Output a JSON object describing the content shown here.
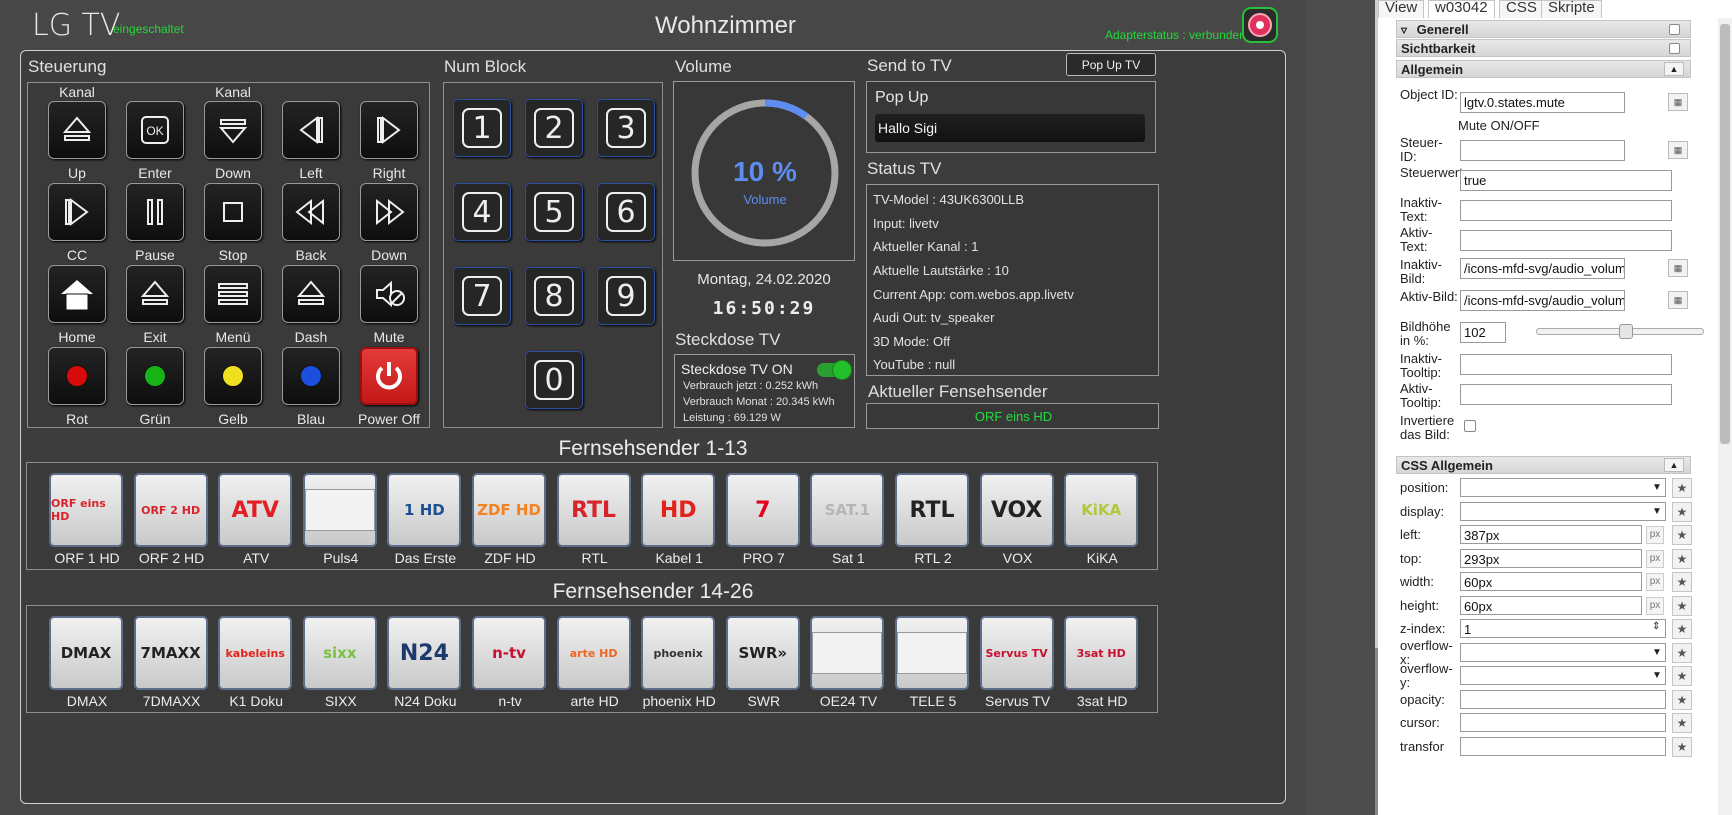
{
  "header": {
    "app_title": "LG TV",
    "app_state": "eingeschaltet",
    "room": "Wohnzimmer",
    "adapter_status": "Adapterstatus : verbunden"
  },
  "sections": {
    "control": "Steuerung",
    "numblock": "Num Block",
    "volume": "Volume",
    "send_to_tv": "Send to TV",
    "status_tv": "Status TV",
    "plug": "Steckdose TV",
    "current_sender": "Aktueller Fensehsender"
  },
  "control": {
    "top_labels": [
      "Kanal",
      "Kanal"
    ],
    "buttons": [
      {
        "label": "Up",
        "icon": "eject-up-icon"
      },
      {
        "label": "Enter",
        "icon": "ok-icon"
      },
      {
        "label": "Down",
        "icon": "eject-down-icon"
      },
      {
        "label": "Left",
        "icon": "arrow-left-icon"
      },
      {
        "label": "Right",
        "icon": "arrow-right-icon"
      },
      {
        "label": "CC",
        "icon": "play-icon"
      },
      {
        "label": "Pause",
        "icon": "pause-icon"
      },
      {
        "label": "Stop",
        "icon": "stop-icon"
      },
      {
        "label": "Back",
        "icon": "rewind-icon"
      },
      {
        "label": "Down",
        "icon": "fast-forward-icon"
      },
      {
        "label": "Home",
        "icon": "home-icon"
      },
      {
        "label": "Exit",
        "icon": "eject-icon"
      },
      {
        "label": "Menü",
        "icon": "menu-icon"
      },
      {
        "label": "Dash",
        "icon": "dash-icon"
      },
      {
        "label": "Mute",
        "icon": "mute-icon"
      },
      {
        "label": "Rot",
        "icon": "red-dot-icon"
      },
      {
        "label": "Grün",
        "icon": "green-dot-icon"
      },
      {
        "label": "Gelb",
        "icon": "yellow-dot-icon"
      },
      {
        "label": "Blau",
        "icon": "blue-dot-icon"
      },
      {
        "label": "Power Off",
        "icon": "power-icon"
      }
    ]
  },
  "numblock": {
    "keys": [
      "1",
      "2",
      "3",
      "4",
      "5",
      "6",
      "7",
      "8",
      "9",
      "0"
    ]
  },
  "volume": {
    "value": 10,
    "text": "10 %",
    "label": "Volume",
    "accent": "#5d8df0"
  },
  "clock": {
    "date": "Montag, 24.02.2020",
    "time": "16:50:29"
  },
  "plug": {
    "title": "Steckdose TV ON",
    "on": true,
    "lines": [
      "Verbrauch jetzt : 0.252 kWh",
      "Verbrauch Monat : 20.345 kWh",
      "Leistung : 69.129 W"
    ]
  },
  "send": {
    "popup_button": "Pop Up TV",
    "popup_label": "Pop Up",
    "popup_value": "Hallo Sigi"
  },
  "status": {
    "lines": [
      "TV-Model : 43UK6300LLB",
      "Input: livetv",
      "Aktueller Kanal : 1",
      "Aktuelle Lautstärke : 10",
      "Current App: com.webos.app.livetv",
      "Audi Out: tv_speaker",
      "3D Mode: Off",
      "YouTube : null"
    ]
  },
  "current_sender": "ORF eins HD",
  "channels_row1": {
    "title": "Fernsehsender 1-13",
    "items": [
      {
        "label": "ORF 1 HD",
        "logo": "ORF eins HD",
        "color": "#d8232a"
      },
      {
        "label": "ORF 2 HD",
        "logo": "ORF 2 HD",
        "color": "#d8232a"
      },
      {
        "label": "ATV",
        "logo": "ATV",
        "color": "#e21d24"
      },
      {
        "label": "Puls4",
        "logo": "",
        "color": "#999999"
      },
      {
        "label": "Das Erste",
        "logo": "1 HD",
        "color": "#1c4f92"
      },
      {
        "label": "ZDF HD",
        "logo": "ZDF HD",
        "color": "#f58220"
      },
      {
        "label": "RTL",
        "logo": "RTL",
        "color": "#d8232a"
      },
      {
        "label": "Kabel 1",
        "logo": "HD",
        "color": "#e2231a"
      },
      {
        "label": "PRO 7",
        "logo": "7",
        "color": "#e2001a"
      },
      {
        "label": "Sat 1",
        "logo": "SAT.1",
        "color": "#b5b5b5"
      },
      {
        "label": "RTL 2",
        "logo": "RTL",
        "color": "#222222"
      },
      {
        "label": "VOX",
        "logo": "VOX",
        "color": "#222222"
      },
      {
        "label": "KiKA",
        "logo": "KiKA",
        "color": "#b0c83c"
      }
    ]
  },
  "channels_row2": {
    "title": "Fernsehsender 14-26",
    "items": [
      {
        "label": "DMAX",
        "logo": "DMAX",
        "color": "#222222"
      },
      {
        "label": "7DMAXX",
        "logo": "7MAXX",
        "color": "#222222"
      },
      {
        "label": "K1 Doku",
        "logo": "kabeleins",
        "color": "#e2231a"
      },
      {
        "label": "SIXX",
        "logo": "sixx",
        "color": "#7bc142"
      },
      {
        "label": "N24 Doku",
        "logo": "N24",
        "color": "#1b3a6b"
      },
      {
        "label": "n-tv",
        "logo": "n-tv",
        "color": "#c8102e"
      },
      {
        "label": "arte HD",
        "logo": "arte HD",
        "color": "#f26522"
      },
      {
        "label": "phoenix HD",
        "logo": "phoenix",
        "color": "#333333"
      },
      {
        "label": "SWR",
        "logo": "SWR»",
        "color": "#222222"
      },
      {
        "label": "OE24 TV",
        "logo": "",
        "color": "#999999"
      },
      {
        "label": "TELE 5",
        "logo": "",
        "color": "#999999"
      },
      {
        "label": "Servus TV",
        "logo": "Servus TV",
        "color": "#c8102e"
      },
      {
        "label": "3sat HD",
        "logo": "3sat HD",
        "color": "#c8102e"
      }
    ]
  },
  "editor": {
    "tabs": [
      "View",
      "w03042",
      "CSS",
      "Skripte"
    ],
    "active_tab": "w03042",
    "sections": {
      "generell": "Generell",
      "sichtbarkeit": "Sichtbarkeit",
      "allgemein": "Allgemein",
      "css_allgemein": "CSS Allgemein"
    },
    "props": {
      "object_id": {
        "label": "Object ID:",
        "value": "lgtv.0.states.mute"
      },
      "object_desc": "Mute ON/OFF",
      "steuer_id": {
        "label": "Steuer-ID:",
        "value": ""
      },
      "steuerwert": {
        "label": "Steuerwert:",
        "value": "true"
      },
      "inaktiv_text": {
        "label": "Inaktiv-Text:",
        "value": ""
      },
      "aktiv_text": {
        "label": "Aktiv-Text:",
        "value": ""
      },
      "inaktiv_bild": {
        "label": "Inaktiv-Bild:",
        "value": "/icons-mfd-svg/audio_volume"
      },
      "aktiv_bild": {
        "label": "Aktiv-Bild:",
        "value": "/icons-mfd-svg/audio_volume"
      },
      "bildhoehe": {
        "label": "Bildhöhe in %:",
        "value": "102"
      },
      "inaktiv_tooltip": {
        "label": "Inaktiv-Tooltip:",
        "value": ""
      },
      "aktiv_tooltip": {
        "label": "Aktiv-Tooltip:",
        "value": ""
      },
      "invert": {
        "label": "Invertiere das Bild:"
      }
    },
    "css": [
      {
        "label": "position:",
        "value": "",
        "type": "select"
      },
      {
        "label": "display:",
        "value": "",
        "type": "select"
      },
      {
        "label": "left:",
        "value": "387px",
        "type": "px"
      },
      {
        "label": "top:",
        "value": "293px",
        "type": "px"
      },
      {
        "label": "width:",
        "value": "60px",
        "type": "px"
      },
      {
        "label": "height:",
        "value": "60px",
        "type": "px"
      },
      {
        "label": "z-index:",
        "value": "1",
        "type": "spin"
      },
      {
        "label": "overflow-x:",
        "value": "",
        "type": "select"
      },
      {
        "label": "overflow-y:",
        "value": "",
        "type": "select"
      },
      {
        "label": "opacity:",
        "value": "",
        "type": "text"
      },
      {
        "label": "cursor:",
        "value": "",
        "type": "text"
      },
      {
        "label": "transfor",
        "value": "",
        "type": "text"
      }
    ],
    "px_unit": "px",
    "star": "★",
    "more": "▦"
  }
}
